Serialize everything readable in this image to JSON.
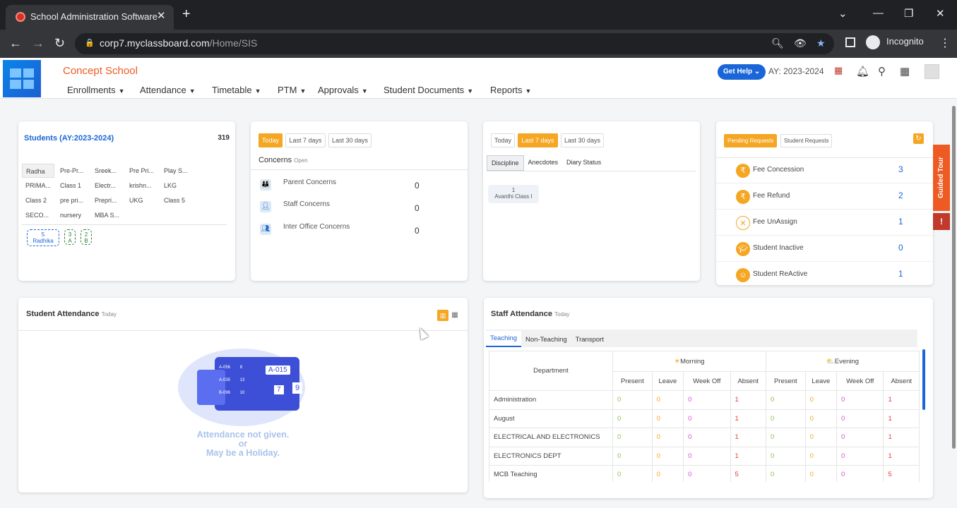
{
  "browser": {
    "tab_title": "School Administration Software",
    "url_host": "corp7.myclassboard.com",
    "url_path": "/Home/SIS",
    "incognito_label": "Incognito"
  },
  "header": {
    "school_name": "Concept School",
    "menu": [
      "Enrollments",
      "Attendance",
      "Timetable",
      "PTM",
      "Approvals",
      "Student Documents",
      "Reports"
    ],
    "get_help": "Get Help",
    "academic_year": "AY: 2023-2024"
  },
  "students": {
    "title": "Students (AY:2023-2024)",
    "count": "319",
    "classes": [
      "Radha",
      "Pre-Pr...",
      "Sreek...",
      "Pre Pri...",
      "Play S...",
      "PRIMA...",
      "Class 1",
      "Electr...",
      "krishn...",
      "LKG",
      "Class 2",
      "pre pri...",
      "Prepri...",
      "UKG",
      "Class 5",
      "SECO...",
      "nursery",
      "MBA S..."
    ],
    "badges": [
      {
        "top": "5",
        "bottom": "Radhika"
      },
      {
        "top": "3",
        "bottom": "A"
      },
      {
        "top": "2",
        "bottom": "B"
      }
    ]
  },
  "concerns": {
    "tabs": [
      "Today",
      "Last 7 days",
      "Last 30 days"
    ],
    "title": "Concerns",
    "subtitle": "Open",
    "rows": [
      {
        "label": "Parent Concerns",
        "value": "0"
      },
      {
        "label": "Staff Concerns",
        "value": "0"
      },
      {
        "label": "Inter Office Concerns",
        "value": "0"
      }
    ]
  },
  "discipline": {
    "tabs": [
      "Today",
      "Last 7 days",
      "Last 30 days"
    ],
    "subtabs": [
      "Discipline",
      "Anecdotes",
      "Diary Status"
    ],
    "item_count": "1",
    "item_label": "Avanthi Class I"
  },
  "requests": {
    "tabs": [
      "Pending Requests",
      "Student Requests"
    ],
    "rows": [
      {
        "label": "Fee Concession",
        "value": "3"
      },
      {
        "label": "Fee Refund",
        "value": "2"
      },
      {
        "label": "Fee UnAssign",
        "value": "1"
      },
      {
        "label": "Student Inactive",
        "value": "0"
      },
      {
        "label": "Student ReActive",
        "value": "1"
      }
    ]
  },
  "student_attendance": {
    "title": "Student Attendance",
    "subtitle": "Today",
    "message_line1": "Attendance not given.",
    "message_line2": "or",
    "message_line3": "May be a Holiday.",
    "illustration_labels": [
      "A-056",
      "8",
      "A-035",
      "13",
      "B-096",
      "10",
      "A-015",
      "7",
      "9"
    ]
  },
  "staff_attendance": {
    "title": "Staff Attendance",
    "subtitle": "Today",
    "tabs": [
      "Teaching",
      "Non-Teaching",
      "Transport"
    ],
    "dept_header": "Department",
    "morning": "Morning",
    "evening": "Evening",
    "cols": [
      "Present",
      "Leave",
      "Week Off",
      "Absent",
      "Present",
      "Leave",
      "Week Off",
      "Absent"
    ],
    "rows": [
      {
        "dept": "Administration",
        "vals": [
          "0",
          "0",
          "0",
          "1",
          "0",
          "0",
          "0",
          "1"
        ]
      },
      {
        "dept": "August",
        "vals": [
          "0",
          "0",
          "0",
          "1",
          "0",
          "0",
          "0",
          "1"
        ]
      },
      {
        "dept": "ELECTRICAL AND ELECTRONICS",
        "vals": [
          "0",
          "0",
          "0",
          "1",
          "0",
          "0",
          "0",
          "1"
        ]
      },
      {
        "dept": "ELECTRONICS DEPT",
        "vals": [
          "0",
          "0",
          "0",
          "1",
          "0",
          "0",
          "0",
          "1"
        ]
      },
      {
        "dept": "MCB Teaching",
        "vals": [
          "0",
          "0",
          "0",
          "5",
          "0",
          "0",
          "0",
          "5"
        ]
      }
    ]
  },
  "side": {
    "guided_tour": "Guided Tour"
  }
}
